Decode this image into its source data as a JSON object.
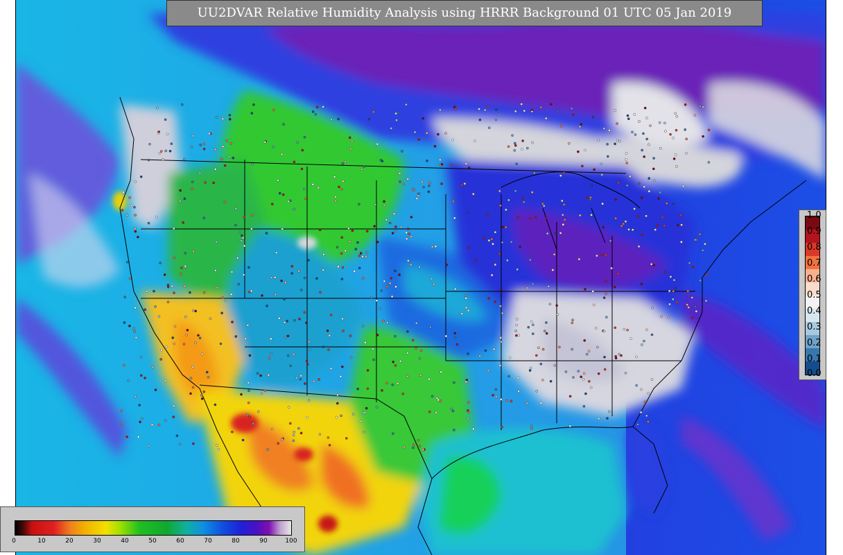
{
  "title": "UU2DVAR Relative Humidity Analysis using HRRR Background 01 UTC 05 Jan 2019",
  "colors": {
    "title_bg": "#8a8a8a",
    "ocean": "#1bb7e8",
    "ocean_dark": "#1c5fe0",
    "dry": "#f5d000",
    "very_dry": "#d82020",
    "moderate": "#2fcf2f",
    "humid": "#2a3fe0",
    "very_humid": "#7a1ab0",
    "saturated": "#d8d8d8"
  },
  "rh_colorbar": {
    "label_min": 0,
    "label_max": 100,
    "ticks": [
      "0",
      "10",
      "20",
      "30",
      "40",
      "50",
      "60",
      "70",
      "80",
      "90",
      "100"
    ]
  },
  "innovation_colorbar": {
    "ticks": [
      "1.0",
      "0.9",
      "0.8",
      "0.7",
      "0.6",
      "0.5",
      "0.4",
      "0.3",
      "0.2",
      "0.1",
      "0.0"
    ],
    "colors": [
      "#7a0a12",
      "#b4141e",
      "#d83a28",
      "#ef7240",
      "#f6b090",
      "#f9dccb",
      "#f2f2f2",
      "#d6e6ef",
      "#a7c9dd",
      "#6ea3c8",
      "#3a76ae",
      "#154c8c"
    ]
  },
  "map": {
    "projection": "Lambert Conformal Conic",
    "region": "CONUS",
    "overlays": [
      "state-boundaries",
      "country-boundaries",
      "coastlines",
      "observation-stations"
    ]
  }
}
